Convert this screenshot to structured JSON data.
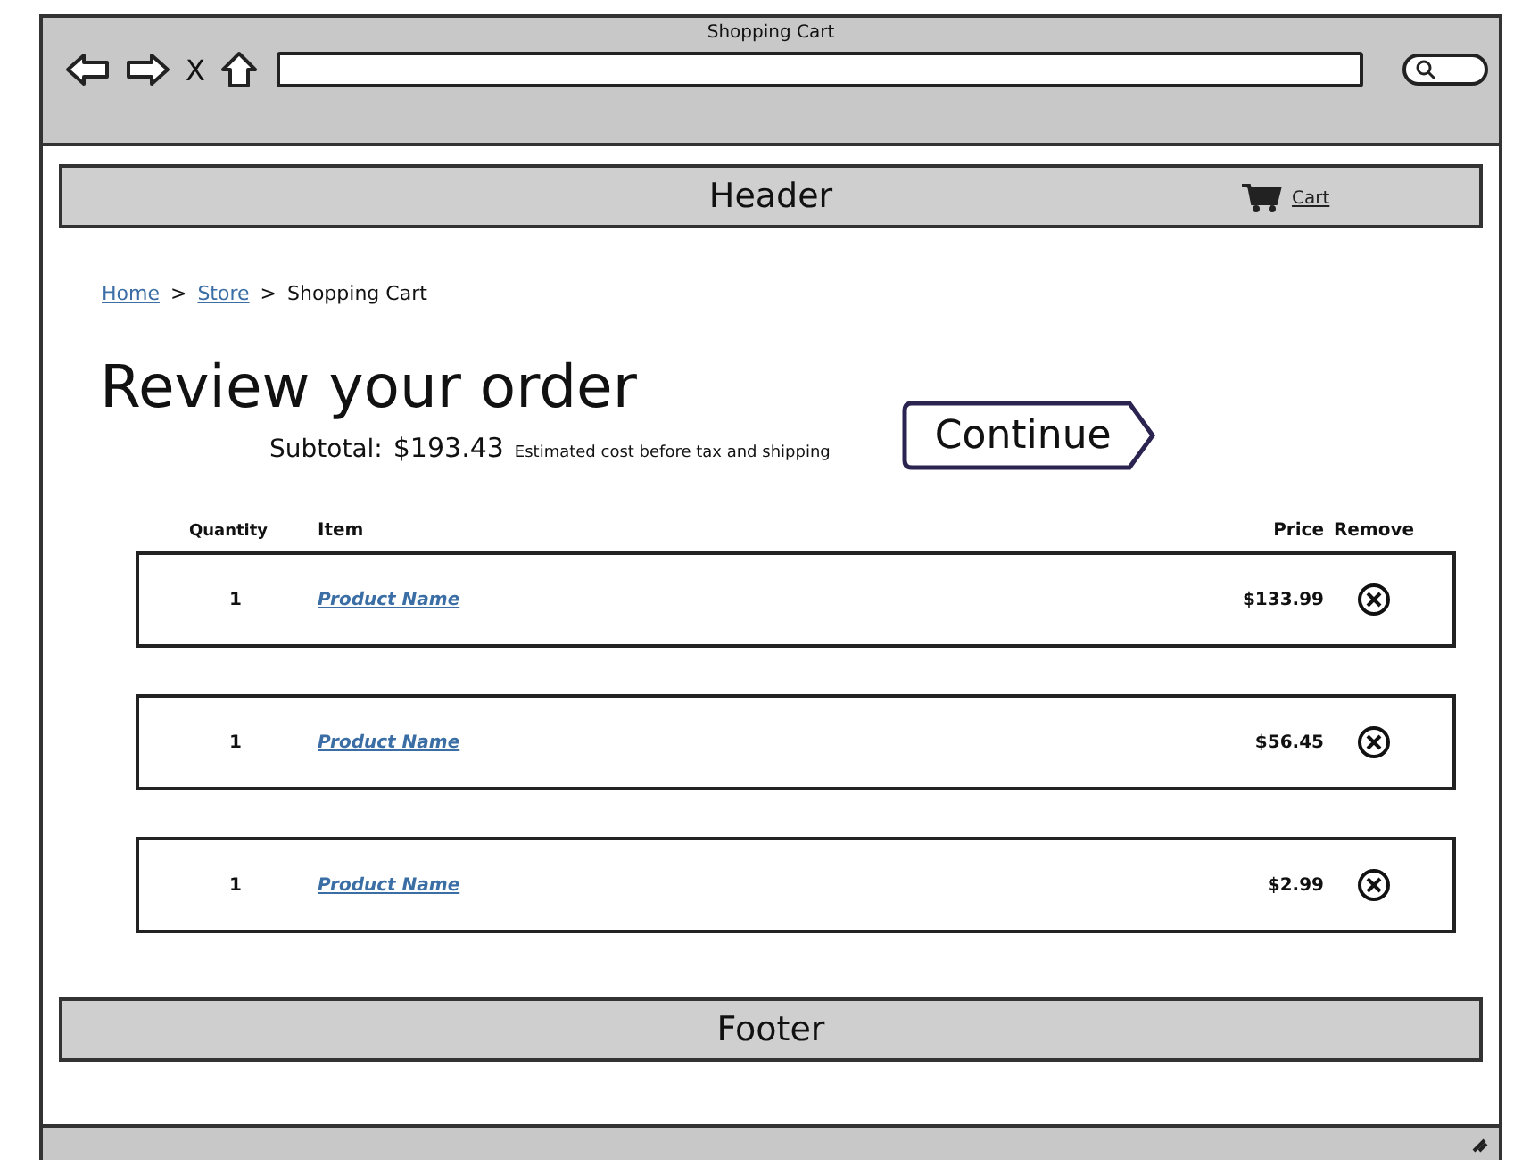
{
  "window": {
    "title": "Shopping Cart"
  },
  "toolbar": {
    "stop_glyph": "X"
  },
  "header": {
    "title": "Header",
    "cart_link": "Cart"
  },
  "breadcrumb": {
    "separator": ">",
    "items": [
      {
        "label": "Home",
        "kind": "link"
      },
      {
        "label": "Store",
        "kind": "link"
      },
      {
        "label": "Shopping Cart",
        "kind": "current"
      }
    ]
  },
  "heading": "Review your order",
  "subtotal": {
    "label": "Subtotal:",
    "amount": "$193.43",
    "note": "Estimated cost before tax and shipping"
  },
  "continue_button": "Continue",
  "table": {
    "columns": [
      "Quantity",
      "Item",
      "Price",
      "Remove"
    ],
    "rows": [
      {
        "quantity": "1",
        "item": "Product Name",
        "price": "$133.99"
      },
      {
        "quantity": "1",
        "item": "Product Name",
        "price": "$56.45"
      },
      {
        "quantity": "1",
        "item": "Product Name",
        "price": "$2.99"
      }
    ]
  },
  "footer": "Footer"
}
